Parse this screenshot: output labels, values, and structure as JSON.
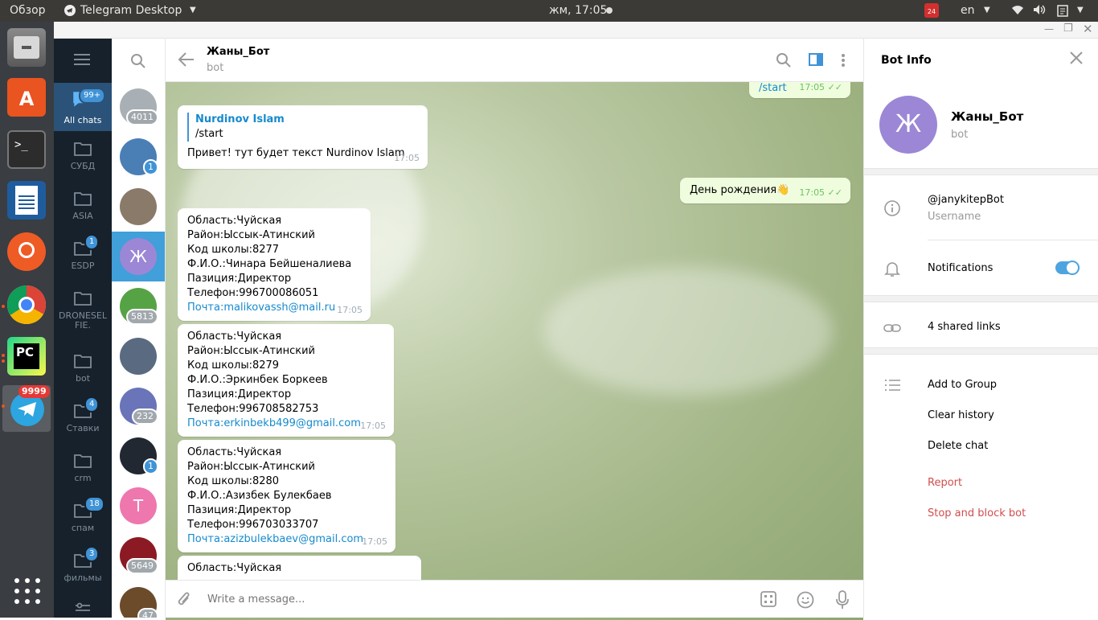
{
  "topbar": {
    "activities": "Обзор",
    "app_name": "Telegram Desktop",
    "clock": "жм, 17:05",
    "lang": "en",
    "calendar_badge": "24"
  },
  "folders": {
    "all_chats": {
      "label": "All chats",
      "badge": "99+"
    },
    "items": [
      {
        "label": "СУБД",
        "badge": ""
      },
      {
        "label": "ASIA",
        "badge": ""
      },
      {
        "label": "ESDP",
        "badge": "1"
      },
      {
        "label": "DRONESEL FIE.",
        "badge": ""
      },
      {
        "label": "bot",
        "badge": ""
      },
      {
        "label": "Ставки",
        "badge": "4"
      },
      {
        "label": "crm",
        "badge": ""
      },
      {
        "label": "спам",
        "badge": "18"
      },
      {
        "label": "фильмы",
        "badge": "3"
      }
    ]
  },
  "launcher": {
    "telegram_badge": "9999"
  },
  "chatlist": {
    "avatars": [
      {
        "badge": "4011",
        "letter": "",
        "color": "#a8b0b6"
      },
      {
        "badge": "1",
        "letter": "",
        "color": "#4a7fb5"
      },
      {
        "badge": "",
        "letter": "",
        "color": "#8a7a6a"
      },
      {
        "badge": "",
        "letter": "Ж",
        "color": "#9b87d6"
      },
      {
        "badge": "5813",
        "letter": "",
        "color": "#56a346"
      },
      {
        "badge": "",
        "letter": "",
        "color": "#5a6a80"
      },
      {
        "badge": "232",
        "letter": "",
        "color": "#6a74b8"
      },
      {
        "badge": "1",
        "letter": "",
        "color": "#222831"
      },
      {
        "badge": "",
        "letter": "T",
        "color": "#ee77ae"
      },
      {
        "badge": "5649",
        "letter": "",
        "color": "#8b1a24"
      },
      {
        "badge": "47",
        "letter": "",
        "color": "#6b4b2a"
      }
    ]
  },
  "chat": {
    "name": "Жаны_Бот",
    "status": "bot",
    "out_top": {
      "text": "/start",
      "time": "17:05"
    },
    "reply_msg": {
      "reply_author": "Nurdinov Islam",
      "reply_text": "/start",
      "text": "Привет! тут будет текст Nurdinov Islam",
      "time": "17:05"
    },
    "out_birthday": {
      "text": "День рождения👋",
      "time": "17:05"
    },
    "records": [
      {
        "lines": [
          "Область:Чуйская",
          "Район:Ыссык-Атинский",
          "Код школы:8277",
          "Ф.И.О.:Чинара Бейшеналиева",
          "Пазиция:Директор",
          "Телефон:996700086051"
        ],
        "email": "Почта:malikovassh@mail.ru",
        "time": "17:05"
      },
      {
        "lines": [
          "Область:Чуйская",
          "Район:Ыссык-Атинский",
          "Код школы:8279",
          "Ф.И.О.:Эркинбек Боркеев",
          "Пазиция:Директор",
          "Телефон:996708582753"
        ],
        "email": "Почта:erkinbekb499@gmail.com",
        "time": "17:05"
      },
      {
        "lines": [
          "Область:Чуйская",
          "Район:Ыссык-Атинский",
          "Код школы:8280",
          "Ф.И.О.:Азизбек Булекбаев",
          "Пазиция:Директор",
          "Телефон:996703033707"
        ],
        "email": "Почта:azizbulekbaev@gmail.com",
        "time": "17:05"
      }
    ],
    "partial": {
      "line1": "Область:Чуйская"
    },
    "composer_placeholder": "Write a message..."
  },
  "info": {
    "title": "Bot Info",
    "name": "Жаны_Бот",
    "status": "bot",
    "avatar_letter": "Ж",
    "username": "@janykitepBot",
    "username_label": "Username",
    "notifications": "Notifications",
    "shared_links": "4 shared links",
    "add_to_group": "Add to Group",
    "clear_history": "Clear history",
    "delete_chat": "Delete chat",
    "report": "Report",
    "stop_block": "Stop and block bot"
  },
  "colors": {
    "accent": "#3f93d6",
    "danger": "#d14e4e",
    "sidebar": "#17212b"
  }
}
